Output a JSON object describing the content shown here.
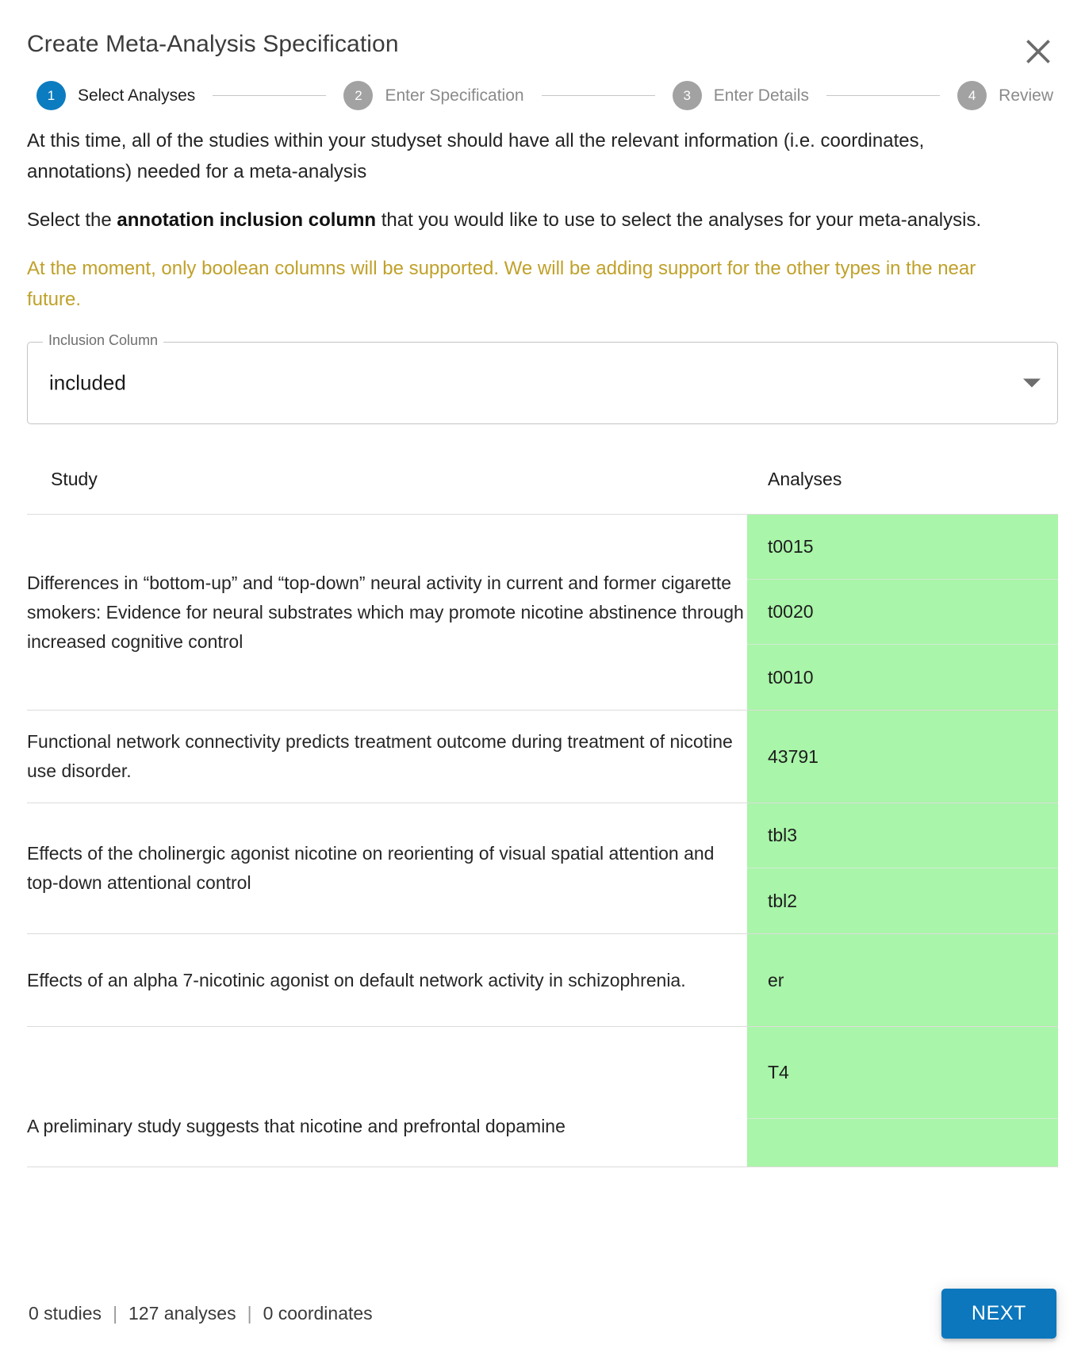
{
  "dialog": {
    "title": "Create Meta-Analysis Specification",
    "close_icon": "close-icon"
  },
  "stepper": {
    "steps": [
      {
        "number": "1",
        "label": "Select Analyses",
        "active": true
      },
      {
        "number": "2",
        "label": "Enter Specification",
        "active": false
      },
      {
        "number": "3",
        "label": "Enter Details",
        "active": false
      },
      {
        "number": "4",
        "label": "Review",
        "active": false
      }
    ]
  },
  "body": {
    "paragraph_1": "At this time, all of the studies within your studyset should have all the relevant information (i.e. coordinates, annotations) needed for a meta-analysis",
    "paragraph_2_pre": "Select the ",
    "paragraph_2_bold": "annotation inclusion column",
    "paragraph_2_post": " that you would like to use to select the analyses for your meta-analysis.",
    "warning": "At the moment, only boolean columns will be supported. We will be adding support for the other types in the near future."
  },
  "inclusion_select": {
    "label": "Inclusion Column",
    "value": "included",
    "arrow_icon": "chevron-down-icon"
  },
  "table": {
    "columns": [
      "Study",
      "Analyses"
    ],
    "rows": [
      {
        "study": "Differences in “bottom-up” and “top-down” neural activity in current and former cigarette smokers: Evidence for neural substrates which may promote nicotine abstinence through increased cognitive control",
        "analyses": [
          "t0015",
          "t0020",
          "t0010"
        ]
      },
      {
        "study": "Functional network connectivity predicts treatment outcome during treatment of nicotine use disorder.",
        "analyses": [
          "43791"
        ]
      },
      {
        "study": "Effects of the cholinergic agonist nicotine on reorienting of visual spatial attention and top-down attentional control",
        "analyses": [
          "tbl3",
          "tbl2"
        ]
      },
      {
        "study": "Effects of an alpha 7-nicotinic agonist on default network activity in schizophrenia.",
        "analyses": [
          "er"
        ]
      },
      {
        "study": "A preliminary study suggests that nicotine and prefrontal dopamine",
        "analyses": [
          "T4",
          ""
        ]
      }
    ]
  },
  "footer": {
    "studies": "0 studies",
    "separator": "|",
    "analyses": "127 analyses",
    "coordinates": "0 coordinates",
    "next_label": "NEXT"
  },
  "colors": {
    "accent_blue": "#0c77bd",
    "step_active": "#0c7cc0",
    "step_inactive": "#a2a2a2",
    "warning": "#c0a12a",
    "analysis_green": "#a9f5a9"
  }
}
